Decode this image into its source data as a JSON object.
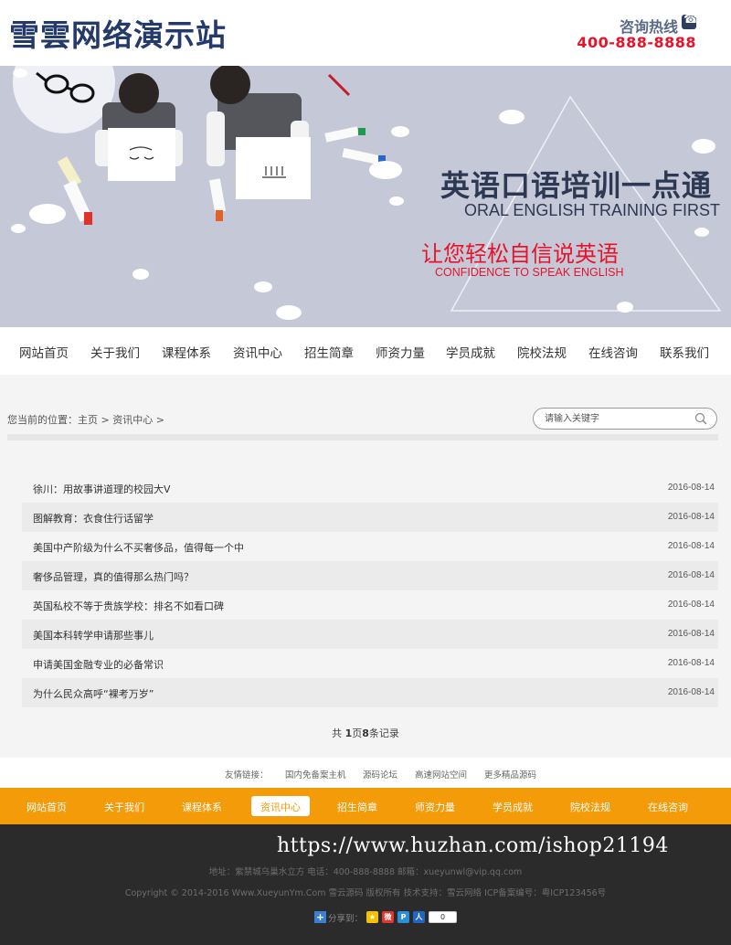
{
  "header": {
    "logo_text": "雪雲网络演示站",
    "hotline_label": "咨询热线",
    "hotline_number": "400-888-8888"
  },
  "banner": {
    "title": "英语口语培训一点通",
    "subtitle": "ORAL ENGLISH TRAINING FIRST",
    "slogan": "让您轻松自信说英语",
    "slogan_en": "CONFIDENCE TO SPEAK ENGLISH",
    "background_color": "#c5c9d7"
  },
  "main_nav": {
    "items": [
      {
        "label": "网站首页"
      },
      {
        "label": "关于我们"
      },
      {
        "label": "课程体系"
      },
      {
        "label": "资讯中心"
      },
      {
        "label": "招生简章"
      },
      {
        "label": "师资力量"
      },
      {
        "label": "学员成就"
      },
      {
        "label": "院校法规"
      },
      {
        "label": "在线咨询"
      },
      {
        "label": "联系我们"
      }
    ]
  },
  "breadcrumb": {
    "prefix": "您当前的位置：",
    "home": "主页",
    "separator": ">",
    "current": "资讯中心"
  },
  "search": {
    "placeholder": "请输入关键字",
    "icon": "search-icon"
  },
  "articles": [
    {
      "title": "徐川：用故事讲道理的校园大V",
      "date": "2016-08-14"
    },
    {
      "title": "图解教育：衣食住行话留学",
      "date": "2016-08-14"
    },
    {
      "title": "美国中产阶级为什么不买奢侈品，值得每一个中",
      "date": "2016-08-14"
    },
    {
      "title": "奢侈品管理，真的值得那么热门吗？",
      "date": "2016-08-14"
    },
    {
      "title": "英国私校不等于贵族学校：排名不如看口碑",
      "date": "2016-08-14"
    },
    {
      "title": "美国本科转学申请那些事儿",
      "date": "2016-08-14"
    },
    {
      "title": "申请美国金融专业的必备常识",
      "date": "2016-08-14"
    },
    {
      "title": "为什么民众高呼“裸考万岁”",
      "date": "2016-08-14"
    }
  ],
  "pagination": {
    "prefix": "共 ",
    "pages": "1",
    "middle": "页",
    "count": "8",
    "suffix": "条记录"
  },
  "friend_links": {
    "label": "友情链接：",
    "items": [
      "国内免备案主机",
      "源码论坛",
      "高速网站空间",
      "更多精品源码"
    ]
  },
  "footer_nav": {
    "items": [
      "网站首页",
      "关于我们",
      "课程体系",
      "资讯中心",
      "招生简章",
      "师资力量",
      "学员成就",
      "院校法规",
      "在线咨询"
    ],
    "active_index": 3,
    "background_color": "#f49b09"
  },
  "footer": {
    "watermark": "https://www.huzhan.com/ishop21194",
    "address_line": "地址：紫禁城乌巢水立方    电话：400-888-8888    邮箱：xueyunwl@vip.qq.com",
    "copyright_line": "Copyright © 2014-2016 Www.XueyunYm.Com 雪云源码 版权所有      技术支持：雪云网络      ICP备案编号：粤ICP123456号",
    "share_label": "分享到：",
    "share_count": "0",
    "share_icons": [
      "qzone-icon",
      "weibo-icon",
      "tencent-weibo-icon",
      "renren-icon"
    ]
  }
}
